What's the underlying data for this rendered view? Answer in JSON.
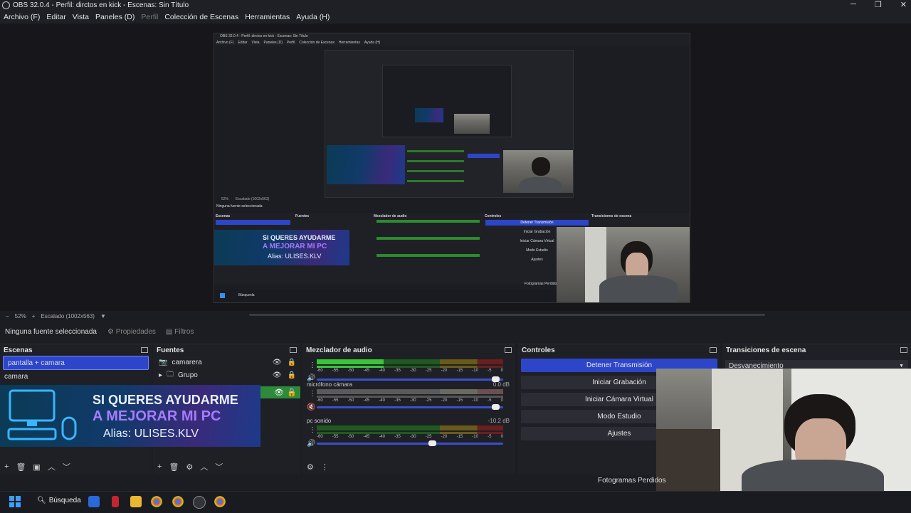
{
  "window": {
    "title": "OBS 32.0.4 - Perfil: dirctos en kick - Escenas: Sin Título",
    "controls": [
      "─",
      "❐",
      "✕"
    ]
  },
  "menu": [
    "Archivo (F)",
    "Editar",
    "Vista",
    "Paneles (D)",
    "Perfil",
    "Colección de Escenas",
    "Herramientas",
    "Ayuda (H)"
  ],
  "nested_preview": {
    "title": "OBS 32.0.4 - Perfil: dirctos en kick - Escenas: Sin Título",
    "menu": [
      "Archivo (F)",
      "Editar",
      "Vista",
      "Paneles (D)",
      "Perfil",
      "Colección de Escenas",
      "Herramientas",
      "Ayuda (H)"
    ],
    "zoom_text": "52%",
    "scale_text": "Escalado (1002x563)",
    "no_source": "Ninguna fuente seleccionada",
    "scenes_head": "Escenas",
    "sources_head": "Fuentes",
    "mixer_head": "Mezclador de audio",
    "controls_head": "Controles",
    "transitions_head": "Transiciones de escena",
    "ctl": [
      "Detener Transmisión",
      "Iniciar Grabación",
      "Iniciar Cámara Virtual",
      "Modo Estudio",
      "Ajustes"
    ],
    "fps": "Fotogramas Perdidos",
    "search": "Búsqueda"
  },
  "statusrow": {
    "zoom": "52%",
    "scale": "Escalado (1002x563)"
  },
  "properties_row": {
    "selection": "Ninguna fuente seleccionada",
    "props": "Propiedades",
    "filters": "Filtros"
  },
  "scenes": {
    "title": "Escenas",
    "items": [
      "pantalla + camara",
      "camara"
    ]
  },
  "sources": {
    "title": "Fuentes",
    "items": [
      "camarera",
      "Grupo"
    ]
  },
  "mixer": {
    "title": "Mezclador de audio",
    "channels": [
      {
        "name": "",
        "db": "",
        "level": 0.36,
        "volume": 0.98
      },
      {
        "name": "micrófono cámara",
        "db": "0.0 dB",
        "level": 0.0,
        "volume": 0.98
      },
      {
        "name": "pc sonido",
        "db": "-10.2 dB",
        "level": 0.0,
        "volume": 0.64
      }
    ],
    "ticks": [
      "-60",
      "-55",
      "-50",
      "-45",
      "-40",
      "-35",
      "-30",
      "-25",
      "-20",
      "-15",
      "-10",
      "-5",
      "0"
    ]
  },
  "controls": {
    "title": "Controles",
    "buttons": [
      "Detener Transmisión",
      "Iniciar Grabación",
      "Iniciar Cámara Virtual",
      "Modo Estudio",
      "Ajustes"
    ]
  },
  "transitions": {
    "title": "Transiciones de escena",
    "selected": "Desvanecimiento"
  },
  "banner": {
    "line1": "SI QUERES AYUDARME",
    "line2": "A MEJORAR MI PC",
    "line3": "Alias: ULISES.KLV"
  },
  "fps": "Fotogramas Perdidos",
  "taskbar": {
    "search": "Búsqueda"
  },
  "colors": {
    "accent": "#2d46c9",
    "meter_green": "#3ac43a"
  }
}
